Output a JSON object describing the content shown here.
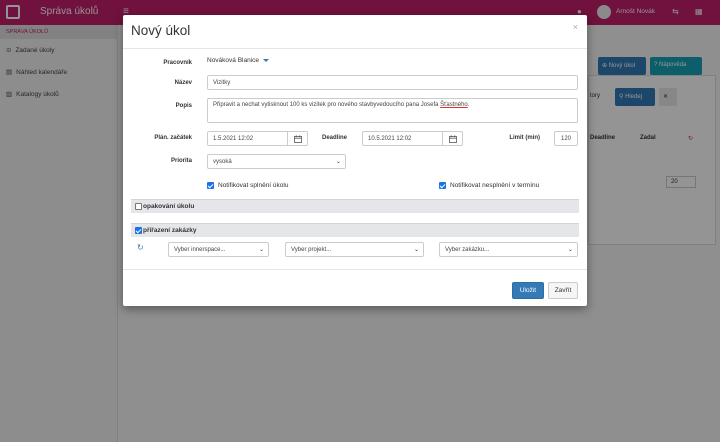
{
  "app": {
    "title": "Správa úkolů",
    "user_name": "Arnošt Novák",
    "sidebar_header": "SPRÁVA ÚKOLŮ",
    "sidebar_items": [
      "Zadané úkoly",
      "Náhled kalendáře",
      "Katalogy úkolů"
    ],
    "new_task_label": "Nový úkol",
    "help_label": "Nápověda",
    "search_label": "Hledej",
    "filter_text": "tory",
    "col_deadline": "Deadline",
    "col_assigned": "Zadal",
    "page_size": "20"
  },
  "modal": {
    "title": "Nový úkol",
    "close": "×",
    "labels": {
      "worker": "Pracovník",
      "name": "Název",
      "description": "Popis",
      "start": "Plán. začátek",
      "deadline": "Deadline",
      "limit": "Limit (min)",
      "priority": "Priorita"
    },
    "worker_value": "Nováková Blanice",
    "name_value": "Vizitky",
    "description_before": "Připravit a nechat vytisknout 100 ks vizitek pro nového stavbyvedoucího pana Josefa ",
    "description_mark": "Šťastného",
    "description_after": ".",
    "start_value": "1.5.2021 12:02",
    "deadline_value": "10.5.2021 12:02",
    "limit_value": "120",
    "priority_value": "vysoká",
    "notify_done": "Notifikovat splnění úkolu",
    "notify_missed": "Notifikovat nesplnění v termínu",
    "section_repeat": "opakování úkolu",
    "section_order": "přiřazení zakázky",
    "select_innerspace": "Vyber innerspace...",
    "select_project": "Vyber projekt...",
    "select_order": "Vyber zakázku...",
    "save_label": "Uložit",
    "close_label": "Zavřít"
  },
  "colors": {
    "brand": "#c21f6a",
    "primary": "#337ab7",
    "checkbox": "#1a73e8"
  }
}
